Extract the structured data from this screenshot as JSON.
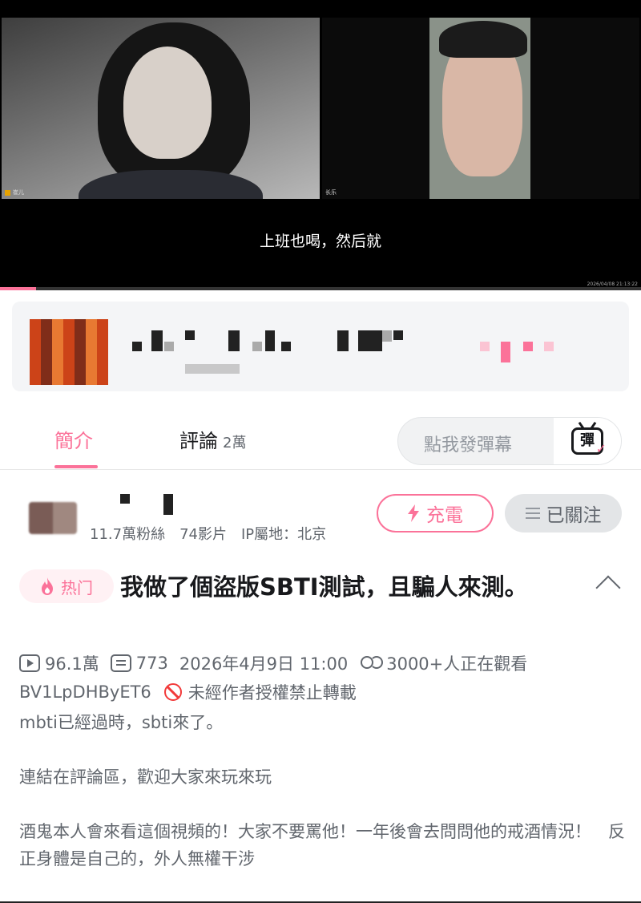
{
  "player": {
    "left_feed_name": "崔儿",
    "right_feed_name": "长乐",
    "subtitle": "上班也喝，然后就",
    "timestamp": "2026/04/08 21:13:22",
    "progress": 0.056
  },
  "tabs": {
    "intro_label": "簡介",
    "comments_label": "評論",
    "comments_count": "2萬",
    "danmaku_placeholder": "點我發彈幕",
    "danmaku_icon_char": "彈"
  },
  "uploader": {
    "stats": "11.7萬粉絲　74影片　IP屬地：北京",
    "charge_label": "充電",
    "follow_label": "已關注"
  },
  "video": {
    "hot_label": "热门",
    "title": "我做了個盜版SBTI測試，且騙人來測。",
    "views": "96.1萬",
    "danmaku_count": "773",
    "publish_time": "2026年4月9日 11:00",
    "watching": "3000+人正在觀看",
    "bvid": "BV1LpDHByET6",
    "repost_notice": "未經作者授權禁止轉載"
  },
  "description": {
    "line1": "mbti已經過時，sbti來了。",
    "line2": "連結在評論區，歡迎大家來玩來玩",
    "line3": "酒鬼本人會來看這個視頻的！大家不要罵他！一年後會去問問他的戒酒情況！　反正身體是自己的，外人無權干涉"
  },
  "colors": {
    "accent": "#fb7299",
    "text_primary": "#18191c",
    "text_secondary": "#61666d",
    "warning": "#f23a3a"
  },
  "icons": [
    "play-count-icon",
    "danmaku-count-icon",
    "viewers-icon",
    "no-repost-icon",
    "flame-icon",
    "lightning-icon",
    "menu-icon",
    "chevron-up-icon",
    "danmaku-tv-icon"
  ]
}
